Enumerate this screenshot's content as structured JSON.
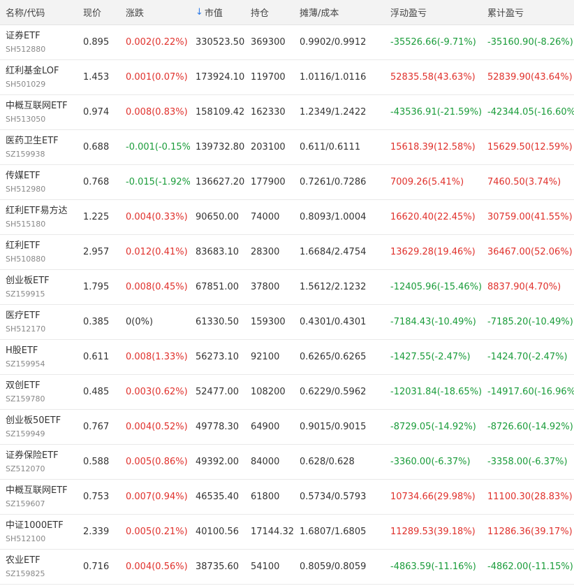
{
  "header": {
    "name": "名称/代码",
    "price": "现价",
    "change": "涨跌",
    "market_value": "市值",
    "holding": "持仓",
    "cost": "摊薄/成本",
    "float_pnl": "浮动盈亏",
    "total_pnl": "累计盈亏",
    "sort_icon": "arrow-down-icon"
  },
  "colors": {
    "up": "#e0312c",
    "down": "#1a9c3a",
    "sort_accent": "#2f7be5"
  },
  "rows": [
    {
      "name": "证券ETF",
      "code": "SH512880",
      "price": "0.895",
      "change": "0.002(0.22%)",
      "change_dir": "up",
      "market_value": "330523.50",
      "holding": "369300",
      "cost": "0.9902/0.9912",
      "float_pnl": "-35526.66(-9.71%)",
      "float_dir": "down",
      "total_pnl": "-35160.90(-8.26%)",
      "total_dir": "down"
    },
    {
      "name": "红利基金LOF",
      "code": "SH501029",
      "price": "1.453",
      "change": "0.001(0.07%)",
      "change_dir": "up",
      "market_value": "173924.10",
      "holding": "119700",
      "cost": "1.0116/1.0116",
      "float_pnl": "52835.58(43.63%)",
      "float_dir": "up",
      "total_pnl": "52839.90(43.64%)",
      "total_dir": "up"
    },
    {
      "name": "中概互联网ETF",
      "code": "SH513050",
      "price": "0.974",
      "change": "0.008(0.83%)",
      "change_dir": "up",
      "market_value": "158109.42",
      "holding": "162330",
      "cost": "1.2349/1.2422",
      "float_pnl": "-43536.91(-21.59%)",
      "float_dir": "down",
      "total_pnl": "-42344.05(-16.60%)",
      "total_dir": "down"
    },
    {
      "name": "医药卫生ETF",
      "code": "SZ159938",
      "price": "0.688",
      "change": "-0.001(-0.15%)",
      "change_dir": "down",
      "market_value": "139732.80",
      "holding": "203100",
      "cost": "0.611/0.6111",
      "float_pnl": "15618.39(12.58%)",
      "float_dir": "up",
      "total_pnl": "15629.50(12.59%)",
      "total_dir": "up"
    },
    {
      "name": "传媒ETF",
      "code": "SH512980",
      "price": "0.768",
      "change": "-0.015(-1.92%)",
      "change_dir": "down",
      "market_value": "136627.20",
      "holding": "177900",
      "cost": "0.7261/0.7286",
      "float_pnl": "7009.26(5.41%)",
      "float_dir": "up",
      "total_pnl": "7460.50(3.74%)",
      "total_dir": "up"
    },
    {
      "name": "红利ETF易方达",
      "code": "SH515180",
      "price": "1.225",
      "change": "0.004(0.33%)",
      "change_dir": "up",
      "market_value": "90650.00",
      "holding": "74000",
      "cost": "0.8093/1.0004",
      "float_pnl": "16620.40(22.45%)",
      "float_dir": "up",
      "total_pnl": "30759.00(41.55%)",
      "total_dir": "up"
    },
    {
      "name": "红利ETF",
      "code": "SH510880",
      "price": "2.957",
      "change": "0.012(0.41%)",
      "change_dir": "up",
      "market_value": "83683.10",
      "holding": "28300",
      "cost": "1.6684/2.4754",
      "float_pnl": "13629.28(19.46%)",
      "float_dir": "up",
      "total_pnl": "36467.00(52.06%)",
      "total_dir": "up"
    },
    {
      "name": "创业板ETF",
      "code": "SZ159915",
      "price": "1.795",
      "change": "0.008(0.45%)",
      "change_dir": "up",
      "market_value": "67851.00",
      "holding": "37800",
      "cost": "1.5612/2.1232",
      "float_pnl": "-12405.96(-15.46%)",
      "float_dir": "down",
      "total_pnl": "8837.90(4.70%)",
      "total_dir": "up"
    },
    {
      "name": "医疗ETF",
      "code": "SH512170",
      "price": "0.385",
      "change": "0(0%)",
      "change_dir": "flat",
      "market_value": "61330.50",
      "holding": "159300",
      "cost": "0.4301/0.4301",
      "float_pnl": "-7184.43(-10.49%)",
      "float_dir": "down",
      "total_pnl": "-7185.20(-10.49%)",
      "total_dir": "down"
    },
    {
      "name": "H股ETF",
      "code": "SZ159954",
      "price": "0.611",
      "change": "0.008(1.33%)",
      "change_dir": "up",
      "market_value": "56273.10",
      "holding": "92100",
      "cost": "0.6265/0.6265",
      "float_pnl": "-1427.55(-2.47%)",
      "float_dir": "down",
      "total_pnl": "-1424.70(-2.47%)",
      "total_dir": "down"
    },
    {
      "name": "双创ETF",
      "code": "SZ159780",
      "price": "0.485",
      "change": "0.003(0.62%)",
      "change_dir": "up",
      "market_value": "52477.00",
      "holding": "108200",
      "cost": "0.6229/0.5962",
      "float_pnl": "-12031.84(-18.65%)",
      "float_dir": "down",
      "total_pnl": "-14917.60(-16.96%)",
      "total_dir": "down"
    },
    {
      "name": "创业板50ETF",
      "code": "SZ159949",
      "price": "0.767",
      "change": "0.004(0.52%)",
      "change_dir": "up",
      "market_value": "49778.30",
      "holding": "64900",
      "cost": "0.9015/0.9015",
      "float_pnl": "-8729.05(-14.92%)",
      "float_dir": "down",
      "total_pnl": "-8726.60(-14.92%)",
      "total_dir": "down"
    },
    {
      "name": "证券保险ETF",
      "code": "SZ512070",
      "price": "0.588",
      "change": "0.005(0.86%)",
      "change_dir": "up",
      "market_value": "49392.00",
      "holding": "84000",
      "cost": "0.628/0.628",
      "float_pnl": "-3360.00(-6.37%)",
      "float_dir": "down",
      "total_pnl": "-3358.00(-6.37%)",
      "total_dir": "down"
    },
    {
      "name": "中概互联网ETF",
      "code": "SZ159607",
      "price": "0.753",
      "change": "0.007(0.94%)",
      "change_dir": "up",
      "market_value": "46535.40",
      "holding": "61800",
      "cost": "0.5734/0.5793",
      "float_pnl": "10734.66(29.98%)",
      "float_dir": "up",
      "total_pnl": "11100.30(28.83%)",
      "total_dir": "up"
    },
    {
      "name": "中证1000ETF",
      "code": "SH512100",
      "price": "2.339",
      "change": "0.005(0.21%)",
      "change_dir": "up",
      "market_value": "40100.56",
      "holding": "17144.32",
      "cost": "1.6807/1.6805",
      "float_pnl": "11289.53(39.18%)",
      "float_dir": "up",
      "total_pnl": "11286.36(39.17%)",
      "total_dir": "up"
    },
    {
      "name": "农业ETF",
      "code": "SZ159825",
      "price": "0.716",
      "change": "0.004(0.56%)",
      "change_dir": "up",
      "market_value": "38735.60",
      "holding": "54100",
      "cost": "0.8059/0.8059",
      "float_pnl": "-4863.59(-11.16%)",
      "float_dir": "down",
      "total_pnl": "-4862.00(-11.15%)",
      "total_dir": "down"
    }
  ]
}
